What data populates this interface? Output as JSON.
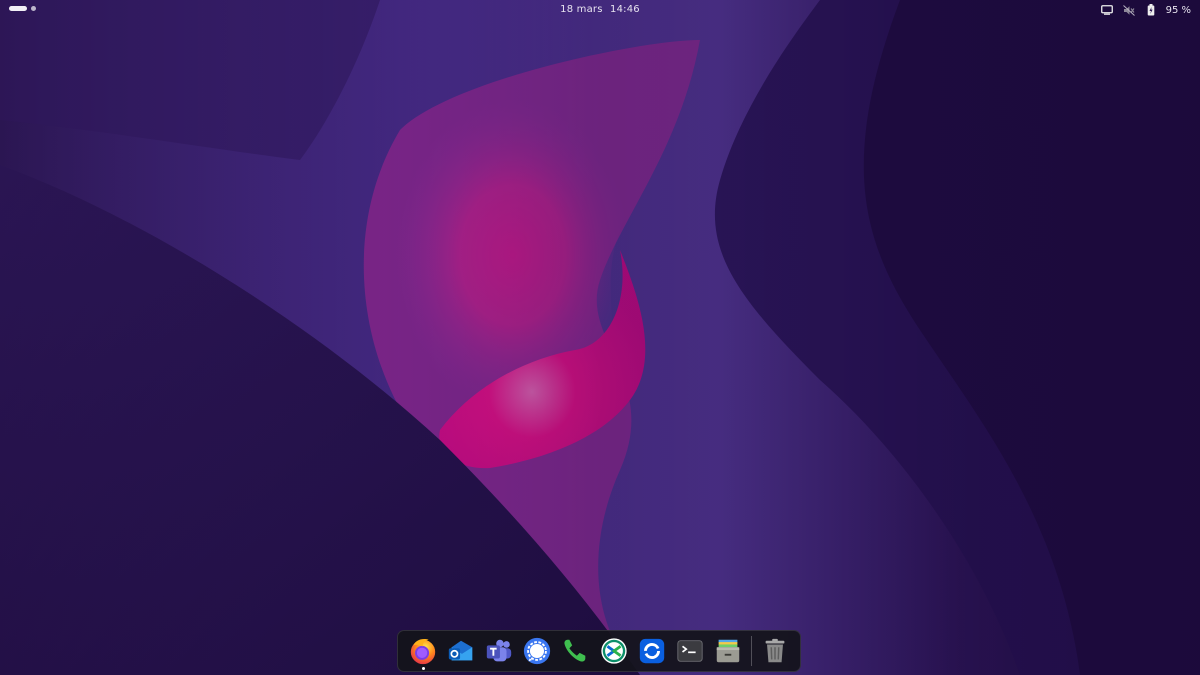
{
  "topbar": {
    "date": "18 mars",
    "time": "14:46",
    "battery_percent": "95 %",
    "tray_icons": [
      "screen-icon",
      "speaker-muted-icon",
      "battery-icon"
    ]
  },
  "workspaces": {
    "count": 2,
    "active_index": 0
  },
  "dock": {
    "apps": [
      {
        "name": "Firefox",
        "icon": "firefox-icon",
        "running": true
      },
      {
        "name": "Outlook",
        "icon": "outlook-icon",
        "running": false
      },
      {
        "name": "Teams",
        "icon": "teams-icon",
        "running": false
      },
      {
        "name": "Signal",
        "icon": "signal-icon",
        "running": false
      },
      {
        "name": "Phone",
        "icon": "phone-icon",
        "running": false
      },
      {
        "name": "Remote Desktop",
        "icon": "remote-desktop-icon",
        "running": false
      },
      {
        "name": "Sync",
        "icon": "sync-icon",
        "running": false
      },
      {
        "name": "Terminal",
        "icon": "terminal-icon",
        "running": false
      },
      {
        "name": "Archive Manager",
        "icon": "archive-icon",
        "running": false
      }
    ],
    "trash": {
      "name": "Trash",
      "icon": "trash-icon"
    }
  },
  "colors": {
    "wallpaper_dark": "#1e0d3d",
    "wallpaper_purple": "#5a3aa0",
    "wallpaper_pink": "#ff0a8a",
    "dock_bg": "#14141a"
  }
}
